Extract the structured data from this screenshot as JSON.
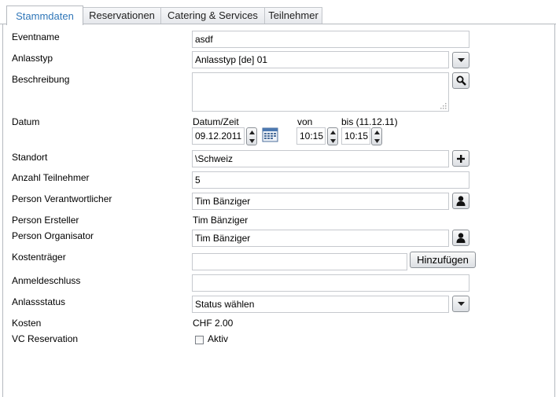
{
  "tabs": [
    "Stammdaten",
    "Reservationen",
    "Catering & Services",
    "Teilnehmer"
  ],
  "active_tab": "Stammdaten",
  "form": {
    "eventname": {
      "label": "Eventname",
      "value": "asdf"
    },
    "anlasstyp": {
      "label": "Anlasstyp",
      "value": "Anlasstyp [de] 01"
    },
    "beschreibung": {
      "label": "Beschreibung",
      "value": ""
    },
    "datum": {
      "label": "Datum",
      "date_header": "Datum/Zeit",
      "date_value": "09.12.2011",
      "from_header": "von",
      "from_value": "10:15",
      "to_header": "bis (11.12.11)",
      "to_value": "10:15"
    },
    "standort": {
      "label": "Standort",
      "value": "\\Schweiz"
    },
    "anzahl_teilnehmer": {
      "label": "Anzahl Teilnehmer",
      "value": "5"
    },
    "person_verantwortlicher": {
      "label": "Person Verantwortlicher",
      "value": "Tim Bänziger"
    },
    "person_ersteller": {
      "label": "Person Ersteller",
      "value": "Tim Bänziger"
    },
    "person_organisator": {
      "label": "Person Organisator",
      "value": "Tim Bänziger"
    },
    "kostentraeger": {
      "label": "Kostenträger",
      "value": "",
      "button": "Hinzufügen"
    },
    "anmeldeschluss": {
      "label": "Anmeldeschluss",
      "value": ""
    },
    "anlassstatus": {
      "label": "Anlassstatus",
      "value": "Status wählen"
    },
    "kosten": {
      "label": "Kosten",
      "value": "CHF 2.00"
    },
    "vc_reservation": {
      "label": "VC Reservation",
      "checkbox_label": "Aktiv",
      "checked": false
    }
  },
  "colors": {
    "active_tab_text": "#2f76b8",
    "border": "#b5b9bf"
  },
  "icons": [
    "dropdown-arrow-icon",
    "search-icon",
    "calendar-icon",
    "spinner-up-icon",
    "spinner-down-icon",
    "plus-icon",
    "person-icon"
  ]
}
